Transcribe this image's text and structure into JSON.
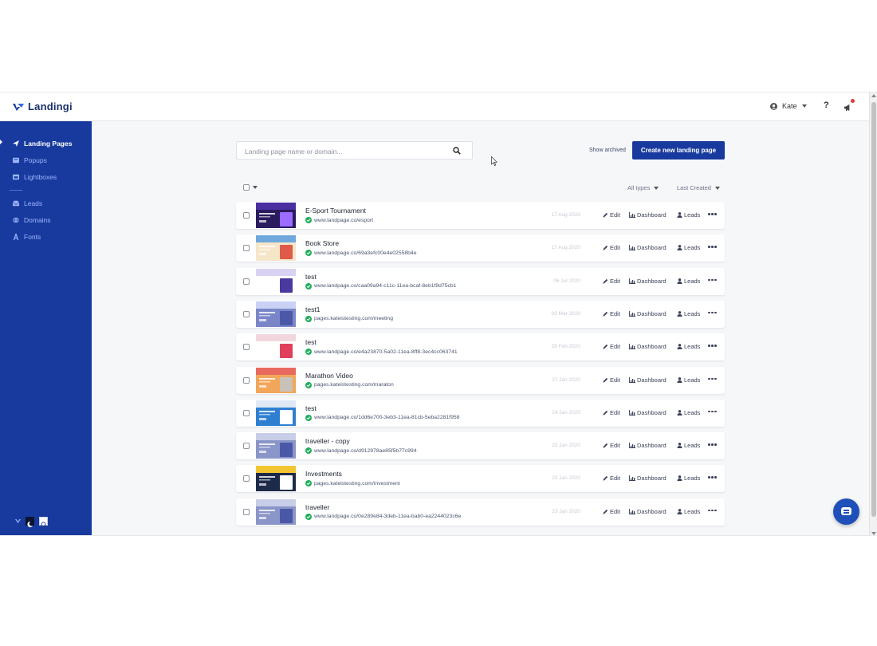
{
  "app": {
    "name": "Landingi",
    "brand_color": "#183a9e"
  },
  "header": {
    "user_name": "Kate",
    "help_label": "?"
  },
  "sidebar": {
    "items": [
      {
        "label": "Landing Pages",
        "icon": "send-icon",
        "active": true
      },
      {
        "label": "Popups",
        "icon": "popup-icon",
        "active": false
      },
      {
        "label": "Lightboxes",
        "icon": "lightbox-icon",
        "active": false
      },
      {
        "label": "Leads",
        "icon": "inbox-icon",
        "active": false
      },
      {
        "label": "Domains",
        "icon": "globe-icon",
        "active": false
      },
      {
        "label": "Fonts",
        "icon": "font-icon",
        "active": false
      }
    ]
  },
  "toolbar": {
    "search_placeholder": "Landing page name or domain...",
    "show_archived": "Show archived",
    "create_label": "Create new landing page",
    "filter_types": "All types",
    "sort_label": "Last Created"
  },
  "row_actions": {
    "edit": "Edit",
    "dashboard": "Dashboard",
    "leads": "Leads"
  },
  "pages": [
    {
      "name": "E-Sport Tournament",
      "url": "www.landpage.co/esport",
      "date": "17 Aug 2020",
      "thumb": [
        "#2a1b5e",
        "#4b2fa0",
        "#9a6cff"
      ]
    },
    {
      "name": "Book Store",
      "url": "www.landpage.co/69a3efc00e4e02558b4e",
      "date": "17 Aug 2020",
      "thumb": [
        "#f5e6c8",
        "#6fa8dc",
        "#e05a4a"
      ]
    },
    {
      "name": "test",
      "url": "www.landpage.co/caa09a94-c11c-11ea-bcaf-8eb1f9d75cb1",
      "date": "06 Jul 2020",
      "thumb": [
        "#ffffff",
        "#d9d2f2",
        "#4a3aa0"
      ]
    },
    {
      "name": "test1",
      "url": "pages.kateistesting.com/meeting",
      "date": "03 Mar 2020",
      "thumb": [
        "#7b86c9",
        "#c9d2f5",
        "#4b58a8"
      ]
    },
    {
      "name": "test",
      "url": "www.landpage.co/e4a23870-5a02-11ea-8ff8-3ec4cc063741",
      "date": "28 Feb 2020",
      "thumb": [
        "#ffffff",
        "#f1d7dd",
        "#e0405b"
      ]
    },
    {
      "name": "Marathon Video",
      "url": "pages.kateistesting.com/maraton",
      "date": "27 Jan 2020",
      "thumb": [
        "#f2a65a",
        "#e86a5f",
        "#c9c2b8"
      ]
    },
    {
      "name": "test",
      "url": "www.landpage.co/1dd6e700-3eb3-11ea-81cb-5eba2281f958",
      "date": "24 Jan 2020",
      "thumb": [
        "#2f7fd1",
        "#dfe9f5",
        "#ffffff"
      ]
    },
    {
      "name": "traveller - copy",
      "url": "www.landpage.co/d912978ae85f5b77c994",
      "date": "23 Jan 2020",
      "thumb": [
        "#8a95c8",
        "#c8cde8",
        "#4b58a8"
      ]
    },
    {
      "name": "Investments",
      "url": "pages.kateistesting.com/investment",
      "date": "23 Jan 2020",
      "thumb": [
        "#1d2a4a",
        "#f3c531",
        "#ffffff"
      ]
    },
    {
      "name": "traveller",
      "url": "www.landpage.co/0e289e84-3deb-11ea-bab0-ea2244023c6e",
      "date": "23 Jan 2020",
      "thumb": [
        "#8a95c8",
        "#c8cde8",
        "#4b58a8"
      ]
    }
  ]
}
